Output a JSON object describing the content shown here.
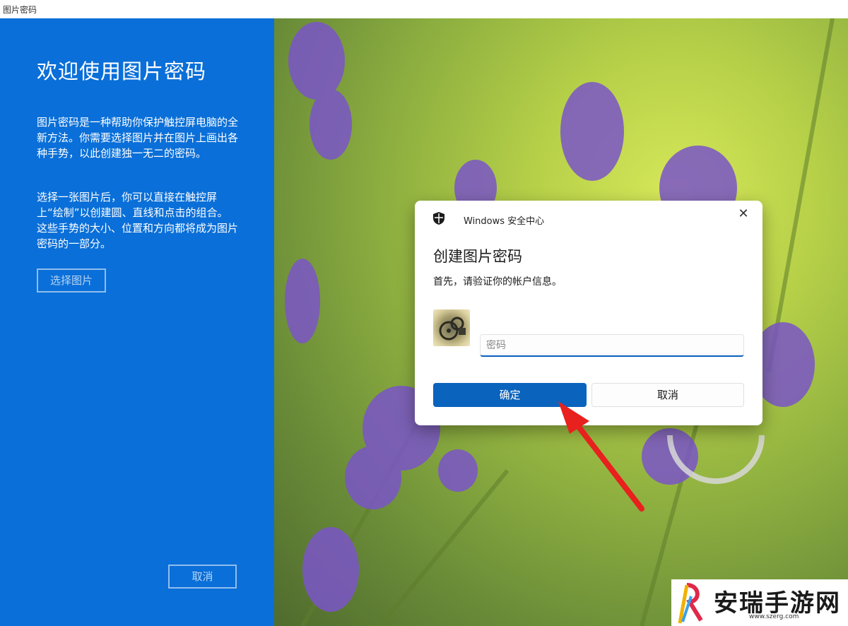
{
  "window": {
    "title": "图片密码"
  },
  "left_panel": {
    "heading": "欢迎使用图片密码",
    "paragraph1": "图片密码是一种帮助你保护触控屏电脑的全新方法。你需要选择图片并在图片上画出各种手势，以此创建独一无二的密码。",
    "paragraph2": "选择一张图片后，你可以直接在触控屏上“绘制”以创建圆、直线和点击的组合。这些手势的大小、位置和方向都将成为图片密码的一部分。",
    "choose_button": "选择图片",
    "cancel_button": "取消"
  },
  "dialog": {
    "app_name": "Windows 安全中心",
    "title": "创建图片密码",
    "subtitle": "首先，请验证你的帐户信息。",
    "password_placeholder": "密码",
    "ok_button": "确定",
    "cancel_button": "取消"
  },
  "watermark": {
    "brand": "安瑞手游网",
    "url": "www.szerg.com"
  },
  "colors": {
    "panel_blue": "#0a6fd8",
    "button_blue": "#0a63bd",
    "arrow_red": "#e8201e"
  },
  "icons": {
    "shield": "shield-icon",
    "close": "close-icon",
    "avatar": "user-avatar-image",
    "rotate": "rotate-gesture-icon"
  }
}
